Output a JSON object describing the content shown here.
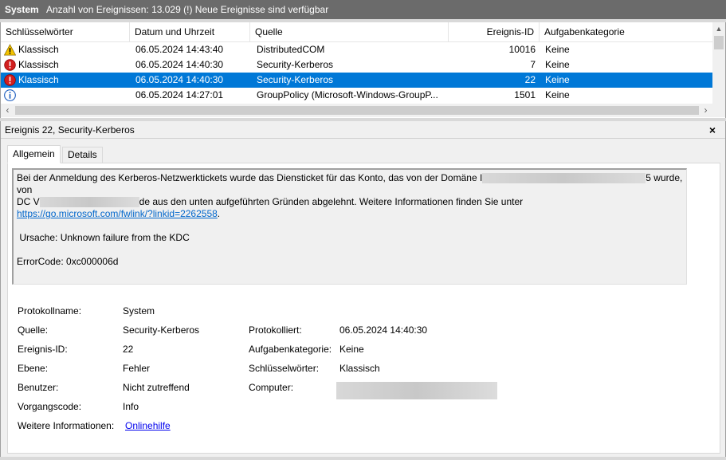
{
  "titlebar": {
    "title": "System",
    "info": "Anzahl von Ereignissen: 13.029 (!) Neue Ereignisse sind verfügbar"
  },
  "table": {
    "columns": [
      "Schlüsselwörter",
      "Datum und Uhrzeit",
      "Quelle",
      "Ereignis-ID",
      "Aufgabenkategorie"
    ],
    "rows": [
      {
        "icon": "warning-icon",
        "keywords": "Klassisch",
        "datetime": "06.05.2024 14:43:40",
        "source": "DistributedCOM",
        "id": "10016",
        "category": "Keine",
        "selected": false
      },
      {
        "icon": "error-icon",
        "keywords": "Klassisch",
        "datetime": "06.05.2024 14:40:30",
        "source": "Security-Kerberos",
        "id": "7",
        "category": "Keine",
        "selected": false
      },
      {
        "icon": "error-icon",
        "keywords": "Klassisch",
        "datetime": "06.05.2024 14:40:30",
        "source": "Security-Kerberos",
        "id": "22",
        "category": "Keine",
        "selected": true
      },
      {
        "icon": "info-icon",
        "keywords": "",
        "datetime": "06.05.2024 14:27:01",
        "source": "GroupPolicy (Microsoft-Windows-GroupP...",
        "id": "1501",
        "category": "Keine",
        "selected": false
      }
    ]
  },
  "details": {
    "title": "Ereignis 22, Security-Kerberos",
    "close": "×",
    "tabs": [
      "Allgemein",
      "Details"
    ],
    "message": {
      "line1_start": "Bei der Anmeldung des Kerberos-Netzwerktickets wurde das Diensticket für das Konto, das von der Domäne I",
      "line1_end": "5 wurde, von",
      "line2_start": "DC V",
      "line2_end": "de aus den unten aufgeführten Gründen abgelehnt. Weitere Informationen finden Sie unter",
      "link": "https://go.microsoft.com/fwlink/?linkid=2262558",
      "link_suffix": ".",
      "cause": " Ursache: Unknown failure from the KDC",
      "errorcode": "ErrorCode: 0xc000006d"
    },
    "properties": {
      "logname_label": "Protokollname:",
      "logname_value": "System",
      "source_label": "Quelle:",
      "source_value": "Security-Kerberos",
      "logged_label": "Protokolliert:",
      "logged_value": "06.05.2024 14:40:30",
      "eventid_label": "Ereignis-ID:",
      "eventid_value": "22",
      "category_label": "Aufgabenkategorie:",
      "category_value": "Keine",
      "level_label": "Ebene:",
      "level_value": "Fehler",
      "keywords_label": "Schlüsselwörter:",
      "keywords_value": "Klassisch",
      "user_label": "Benutzer:",
      "user_value": "Nicht zutreffend",
      "computer_label": "Computer:",
      "opcode_label": "Vorgangscode:",
      "opcode_value": "Info",
      "moreinfo_label": "Weitere Informationen:",
      "moreinfo_value": "Onlinehilfe"
    }
  },
  "colors": {
    "selection": "#0078d7",
    "link": "#0066cc",
    "titlebar": "#6b6b6b"
  }
}
